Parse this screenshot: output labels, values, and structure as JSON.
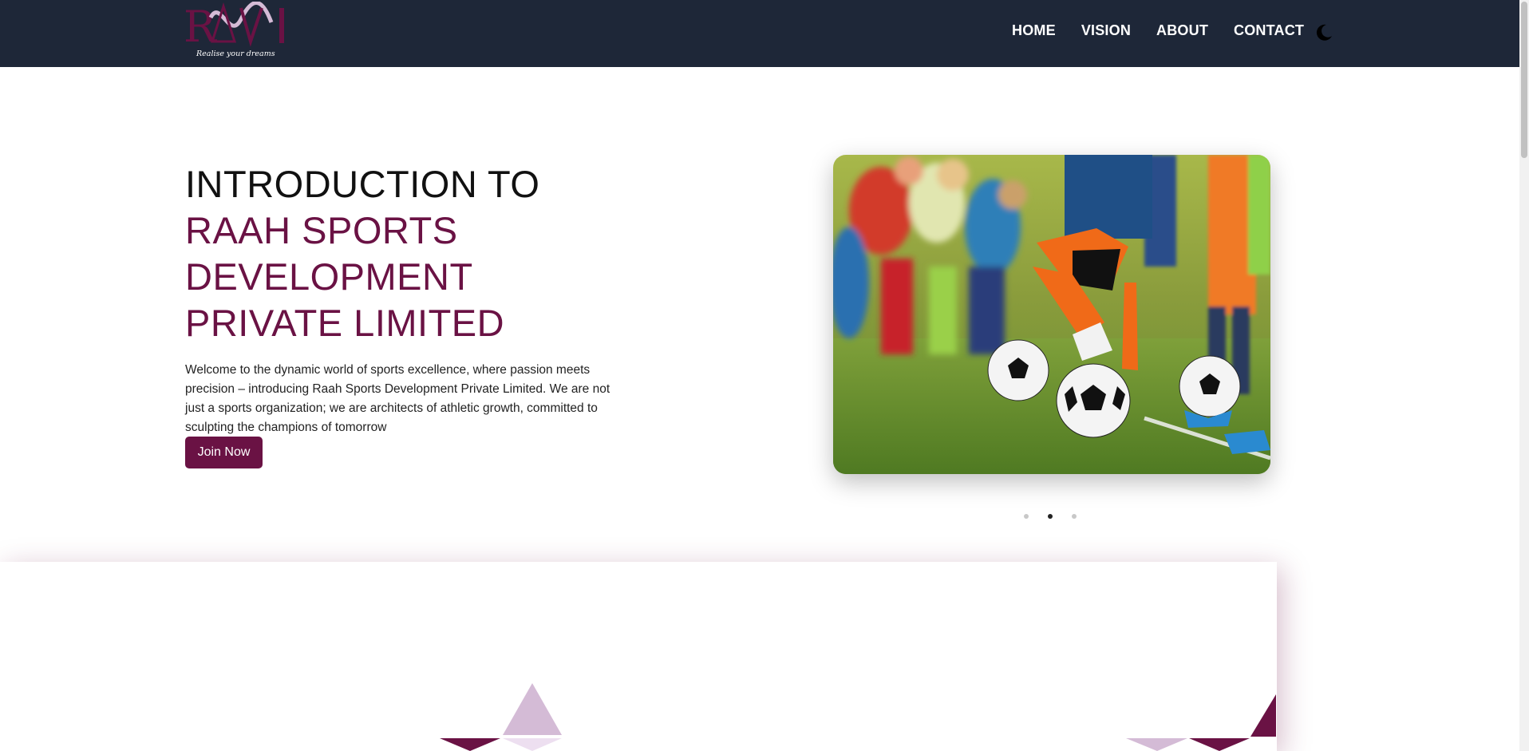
{
  "brand": {
    "tagline": "Realise your dreams"
  },
  "nav": {
    "items": [
      {
        "label": "HOME"
      },
      {
        "label": "VISION"
      },
      {
        "label": "ABOUT"
      },
      {
        "label": "CONTACT"
      }
    ],
    "theme_icon": "moon-icon"
  },
  "hero": {
    "title_line1": "INTRODUCTION TO",
    "title_line2": "RAAH SPORTS DEVELOPMENT PRIVATE LIMITED",
    "description": "Welcome to the dynamic world of sports excellence, where passion meets precision – introducing Raah Sports Development Private Limited. We are not just a sports organization; we are architects of athletic growth, committed to sculpting the champions of tomorrow",
    "cta_label": "Join Now",
    "image_subject": "kids-soccer-practice-photo",
    "carousel": {
      "slide_count": 3,
      "active_slide": 2
    }
  },
  "colors": {
    "navbar_bg": "#1e2738",
    "accent": "#6a1244",
    "accent_light": "#d4bbd6",
    "text": "#111111"
  }
}
